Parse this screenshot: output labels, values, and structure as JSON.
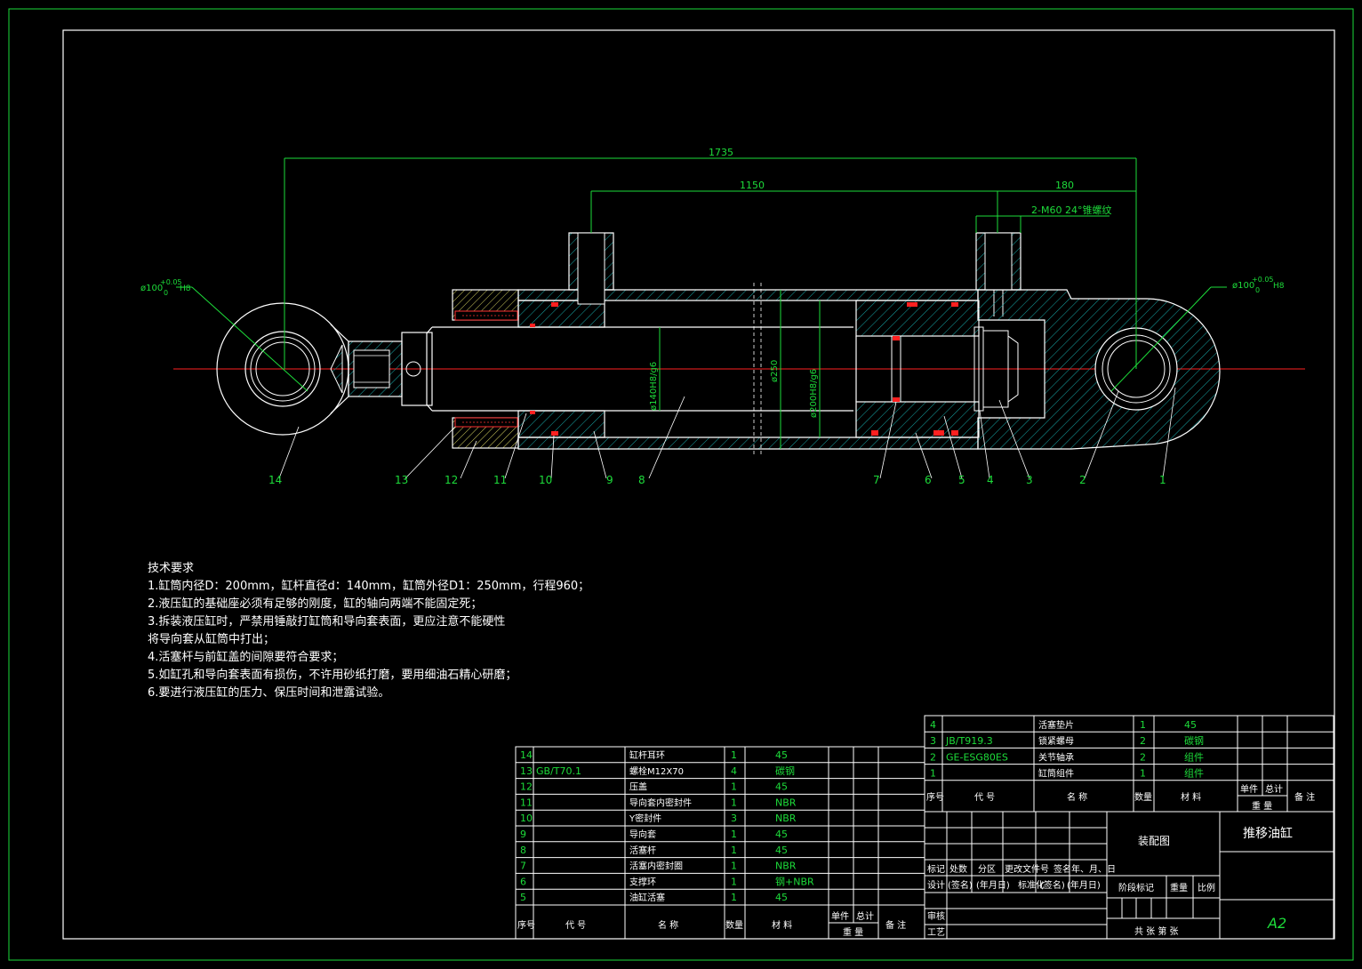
{
  "dimensions": {
    "overall": "1735",
    "port_distance": "1150",
    "eye_offset": "180",
    "port_thread": "2-M60 24°锥螺纹",
    "pin_left": "ø100",
    "pin_right": "ø100",
    "pin_tol": "+0.05",
    "pin_tol_low": "0",
    "pin_fit": "H8",
    "rod_dia": "ø140H8/g6",
    "barrel_outer": "ø250",
    "bore_dia": "ø200H8/g6"
  },
  "balloons": [
    "14",
    "13",
    "12",
    "11",
    "10",
    "9",
    "8",
    "7",
    "6",
    "5",
    "4",
    "3",
    "2",
    "1"
  ],
  "notes": {
    "title": "技术要求",
    "lines": [
      "1.缸筒内径D：200mm，缸杆直径d：140mm，缸筒外径D1：250mm，行程960；",
      "2.液压缸的基础座必须有足够的刚度，缸的轴向两端不能固定死；",
      "3.拆装液压缸时，严禁用锤敲打缸筒和导向套表面，更应注意不能硬性",
      "将导向套从缸筒中打出；",
      "4.活塞杆与前缸盖的间隙要符合要求；",
      "5.如缸孔和导向套表面有损伤，不许用砂纸打磨，要用细油石精心研磨；",
      "6.要进行液压缸的压力、保压时间和泄露试验。"
    ]
  },
  "bom_left": {
    "rows": [
      {
        "no": "14",
        "code": "",
        "name": "缸杆耳环",
        "qty": "1",
        "mat": "45"
      },
      {
        "no": "13",
        "code": "GB/T70.1",
        "name": "螺栓M12X70",
        "qty": "4",
        "mat": "碳钢"
      },
      {
        "no": "12",
        "code": "",
        "name": "压盖",
        "qty": "1",
        "mat": "45"
      },
      {
        "no": "11",
        "code": "",
        "name": "导向套内密封件",
        "qty": "1",
        "mat": "NBR"
      },
      {
        "no": "10",
        "code": "",
        "name": "Y密封件",
        "qty": "3",
        "mat": "NBR"
      },
      {
        "no": "9",
        "code": "",
        "name": "导向套",
        "qty": "1",
        "mat": "45"
      },
      {
        "no": "8",
        "code": "",
        "name": "活塞杆",
        "qty": "1",
        "mat": "45"
      },
      {
        "no": "7",
        "code": "",
        "name": "活塞内密封圈",
        "qty": "1",
        "mat": "NBR"
      },
      {
        "no": "6",
        "code": "",
        "name": "支撑环",
        "qty": "1",
        "mat": "钢+NBR"
      },
      {
        "no": "5",
        "code": "",
        "name": "油缸活塞",
        "qty": "1",
        "mat": "45"
      }
    ],
    "header": {
      "no": "序号",
      "code": "代  号",
      "name": "名  称",
      "qty": "数量",
      "mat": "材  料",
      "unit": "单件",
      "total": "总计",
      "weight": "重  量",
      "remark": "备 注"
    }
  },
  "bom_right": {
    "rows": [
      {
        "no": "4",
        "code": "",
        "name": "活塞垫片",
        "qty": "1",
        "mat": "45"
      },
      {
        "no": "3",
        "code": "JB/T919.3",
        "name": "锁紧螺母",
        "qty": "2",
        "mat": "碳钢"
      },
      {
        "no": "2",
        "code": "GE-ESG80ES",
        "name": "关节轴承",
        "qty": "2",
        "mat": "组件"
      },
      {
        "no": "1",
        "code": "",
        "name": "缸筒组件",
        "qty": "1",
        "mat": "组件"
      }
    ],
    "header": {
      "no": "序号",
      "code": "代  号",
      "name": "名  称",
      "qty": "数量",
      "mat": "材  料",
      "unit": "单件",
      "total": "总计",
      "weight": "重  量",
      "remark": "备 注"
    }
  },
  "title_block": {
    "drawing_type": "装配图",
    "drawing_name": "推移油缸",
    "revision_row": [
      "标记",
      "处数",
      "分区",
      "更改文件号",
      "签名",
      "年、月、日"
    ],
    "design_row": [
      "设计",
      "(签名)",
      "(年月日)",
      "标准化",
      "(签名)",
      "(年月日)"
    ],
    "stage": "阶段标记",
    "weight": "重量",
    "scale": "比例",
    "review": "审核",
    "process": "工艺",
    "sheets": "共   张   第   张",
    "format": "A2"
  },
  "colors": {
    "line": "#ffffff",
    "dim": "#1ddc3a",
    "hatch": "#16a7a7",
    "section": "#d4d060",
    "seal": "#ff2020",
    "center": "#ff2020"
  }
}
